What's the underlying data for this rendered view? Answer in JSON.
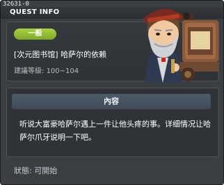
{
  "window": {
    "id_text": "32631-0",
    "title": "QUEST INFO"
  },
  "quest": {
    "badge": "一般",
    "title": "[次元图书馆] 哈萨尔的依赖",
    "level_label": "建議等級:",
    "level_range": "100~104",
    "portrait_icon": "npc-portrait-hassar"
  },
  "content": {
    "header": "內容",
    "body": "听说大富豪哈萨尔遇上一件让他头疼的事。详细情况让哈萨尔爪牙说明一下吧。"
  },
  "status": {
    "label": "狀態:",
    "value": "可開始"
  },
  "colors": {
    "window_bg": "#3b3f44",
    "badge_green": "#8fbf2e",
    "content_header": "#465461"
  }
}
